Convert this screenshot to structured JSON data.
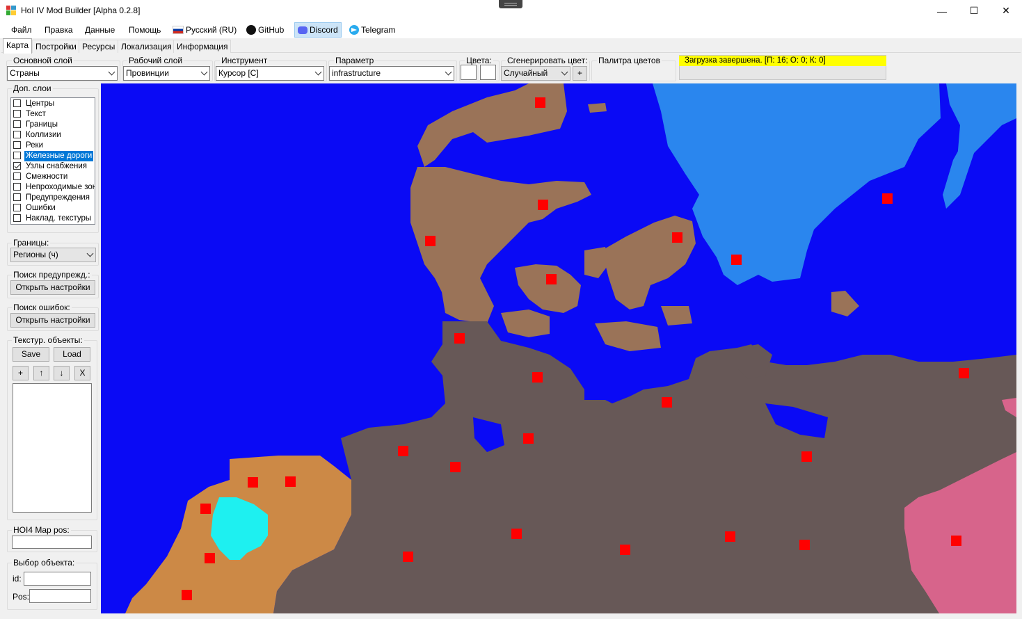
{
  "window": {
    "title": "HoI IV Mod Builder [Alpha 0.2.8]",
    "minimize": "—",
    "maximize": "☐",
    "close": "✕"
  },
  "menu": {
    "file": "Файл",
    "edit": "Правка",
    "data": "Данные",
    "help": "Помощь",
    "language": "Русский (RU)",
    "github": "GitHub",
    "discord": "Discord",
    "telegram": "Telegram"
  },
  "tabs": [
    "Карта",
    "Постройки",
    "Ресурсы",
    "Локализация",
    "Информация"
  ],
  "toolbar": {
    "main_layer": {
      "label": "Основной слой",
      "value": "Страны"
    },
    "work_layer": {
      "label": "Рабочий слой",
      "value": "Провинции"
    },
    "tool": {
      "label": "Инструмент",
      "value": "Курсор [C]"
    },
    "parameter": {
      "label": "Параметр",
      "value": "infrastructure"
    },
    "colors_label": "Цвета:",
    "generate": {
      "label": "Сгенерировать цвет:",
      "value": "Случайный",
      "plus": "+"
    },
    "palette_label": "Палитра цветов",
    "status": "Загрузка завершена. [П: 16; О: 0; К: 0]"
  },
  "sidebar": {
    "layers_title": "Доп. слои",
    "layers": [
      {
        "label": "Центры",
        "checked": false,
        "selected": false
      },
      {
        "label": "Текст",
        "checked": false,
        "selected": false
      },
      {
        "label": "Границы",
        "checked": false,
        "selected": false
      },
      {
        "label": "Коллизии",
        "checked": false,
        "selected": false
      },
      {
        "label": "Реки",
        "checked": false,
        "selected": false
      },
      {
        "label": "Железные дороги",
        "checked": false,
        "selected": true
      },
      {
        "label": "Узлы снабжения",
        "checked": true,
        "selected": false
      },
      {
        "label": "Смежности",
        "checked": false,
        "selected": false
      },
      {
        "label": "Непроходимые зоны",
        "checked": false,
        "selected": false
      },
      {
        "label": "Предупреждения",
        "checked": false,
        "selected": false
      },
      {
        "label": "Ошибки",
        "checked": false,
        "selected": false
      },
      {
        "label": "Наклад. текстуры",
        "checked": false,
        "selected": false
      }
    ],
    "borders": {
      "label": "Границы:",
      "value": "Регионы (ч)"
    },
    "warn_search": {
      "label": "Поиск предупрежд.:",
      "button": "Открыть настройки"
    },
    "error_search": {
      "label": "Поиск ошибок:",
      "button": "Открыть настройки"
    },
    "texture_objects": {
      "label": "Текстур. объекты:",
      "save": "Save",
      "load": "Load",
      "add": "+",
      "up": "↑",
      "down": "↓",
      "remove": "X"
    },
    "map_pos": {
      "label": "HOI4 Map pos:",
      "value": ""
    },
    "object_select": {
      "label": "Выбор объекта:",
      "id_label": "id:",
      "pos_label": "Pos:",
      "id_value": "",
      "pos_value": ""
    }
  },
  "map": {
    "colors": {
      "sea": "#0a0af5",
      "sea_light": "#2a86ee",
      "denmark": "#9a7358",
      "germany": "#675857",
      "netherlands": "#cc8946",
      "poland": "#d7648b",
      "lake": "#1ef0f0",
      "supply_node": "#ff0000"
    }
  }
}
